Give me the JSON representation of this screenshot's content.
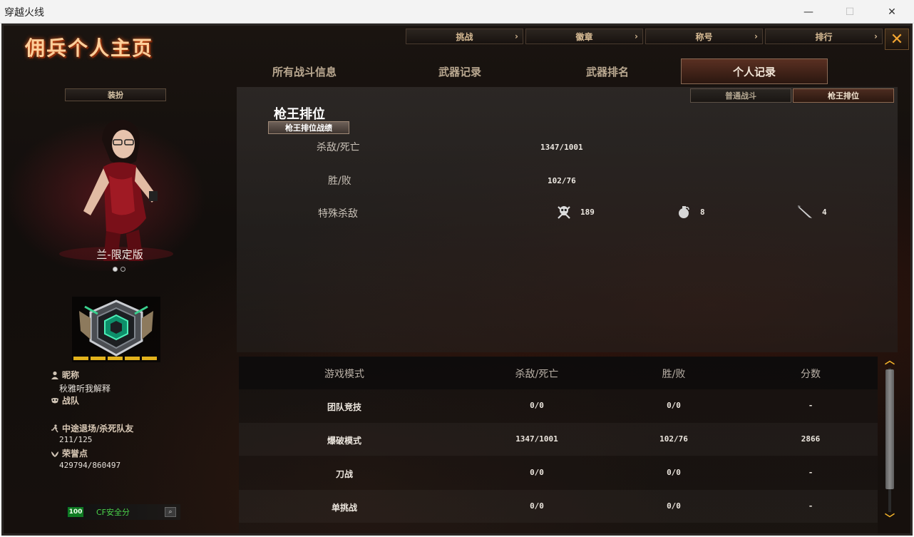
{
  "window": {
    "title": "穿越火线"
  },
  "app": {
    "title": "佣兵个人主页"
  },
  "top_nav": [
    {
      "label": "挑战"
    },
    {
      "label": "徽章"
    },
    {
      "label": "称号"
    },
    {
      "label": "排行"
    }
  ],
  "tabs": [
    {
      "label": "所有战斗信息",
      "active": false
    },
    {
      "label": "武器记录",
      "active": false
    },
    {
      "label": "武器排名",
      "active": false
    },
    {
      "label": "个人记录",
      "active": true
    }
  ],
  "left": {
    "equip_label": "装扮",
    "character_name": "兰-限定版",
    "rank_stars": 5,
    "nickname_label": "昵称",
    "nickname": "秋雅听我解释",
    "team_label": "战队",
    "quit_label": "中途退场/杀死队友",
    "quit_value": "211/125",
    "honor_label": "荣誉点",
    "honor_value": "429794/860497",
    "safety_score": "100",
    "safety_label": "CF安全分"
  },
  "stats": {
    "sub_tabs": [
      "普通战斗",
      "枪王排位"
    ],
    "section_title": "枪王排位",
    "section_sub": "枪王排位战绩",
    "kd_label": "杀敌/死亡",
    "kd_value": "1347/1001",
    "wl_label": "胜/败",
    "wl_value": "102/76",
    "special_label": "特殊杀敌",
    "special": [
      {
        "icon": "skull-icon",
        "value": "189"
      },
      {
        "icon": "grenade-icon",
        "value": "8"
      },
      {
        "icon": "knife-icon",
        "value": "4"
      }
    ]
  },
  "table": {
    "headers": [
      "游戏模式",
      "杀敌/死亡",
      "胜/败",
      "分数"
    ],
    "rows": [
      {
        "mode": "团队竞技",
        "kd": "0/0",
        "wl": "0/0",
        "score": "-"
      },
      {
        "mode": "爆破模式",
        "kd": "1347/1001",
        "wl": "102/76",
        "score": "2866"
      },
      {
        "mode": "刀战",
        "kd": "0/0",
        "wl": "0/0",
        "score": "-"
      },
      {
        "mode": "单挑战",
        "kd": "0/0",
        "wl": "0/0",
        "score": "-"
      }
    ]
  },
  "colors": {
    "accent": "#f2b22a",
    "safety_green": "#0f7a23",
    "title_orange": "#ffcf9a"
  }
}
